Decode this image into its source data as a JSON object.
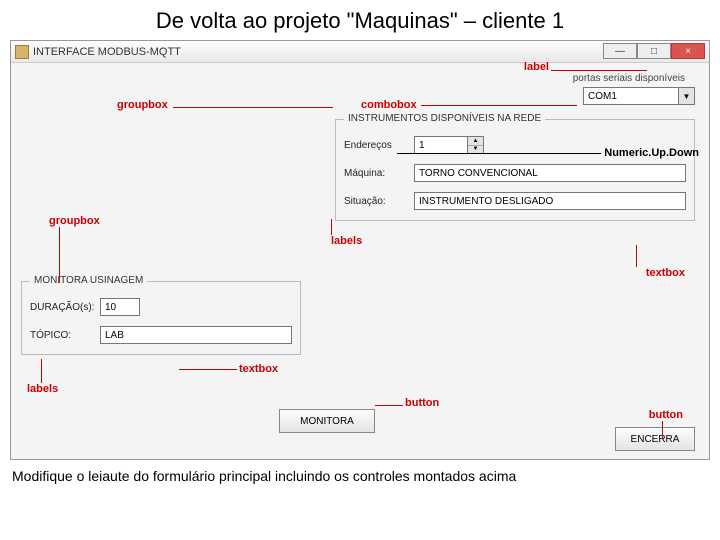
{
  "page": {
    "title": "De volta ao projeto \"Maquinas\" – cliente 1",
    "footer": "Modifique o leiaute do formulário principal incluindo os controles montados acima"
  },
  "window": {
    "title": "INTERFACE MODBUS-MQTT",
    "minimize": "—",
    "maximize": "□",
    "close": "×"
  },
  "serial": {
    "label": "portas seriais disponíveis",
    "value": "COM1"
  },
  "group_instr": {
    "legend": "INSTRUMENTOS DISPONÍVEIS NA REDE",
    "endereco_label": "Endereços",
    "endereco_value": "1",
    "maquina_label": "Máquina:",
    "maquina_value": "TORNO CONVENCIONAL",
    "situacao_label": "Situação:",
    "situacao_value": "INSTRUMENTO DESLIGADO"
  },
  "group_mon": {
    "legend": "MONITORA USINAGEM",
    "duracao_label": "DURAÇÃO(s):",
    "duracao_value": "10",
    "topico_label": "TÓPICO:",
    "topico_value": "LAB"
  },
  "buttons": {
    "monitor": "MONITORA",
    "encerra": "ENCERRA"
  },
  "ann": {
    "label": "label",
    "groupbox": "groupbox",
    "combobox": "combobox",
    "numeric": "Numeric.Up.Down",
    "labels": "labels",
    "textbox": "textbox",
    "button": "button"
  }
}
